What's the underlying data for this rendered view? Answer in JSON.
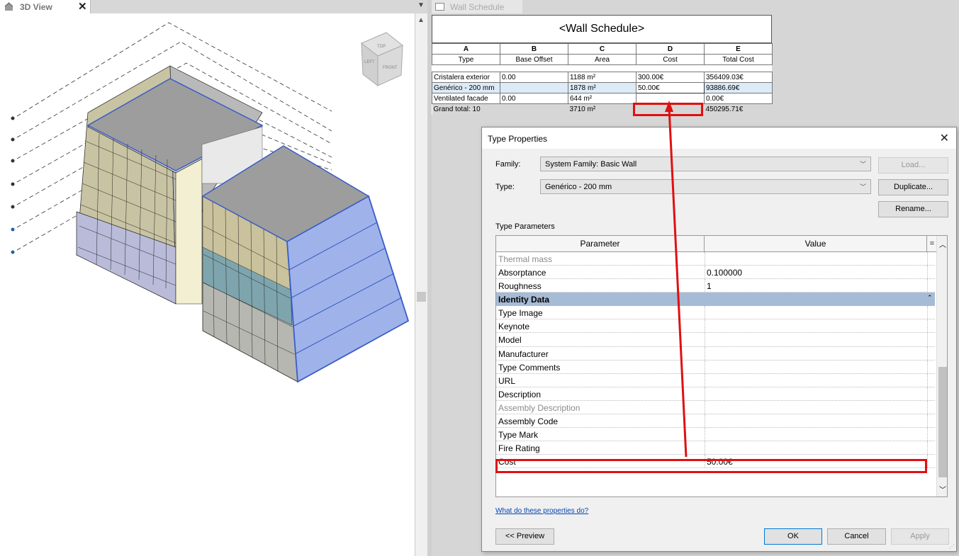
{
  "left_view": {
    "tab_label": "3D View",
    "close_glyph": "✕",
    "viewcube": {
      "top": "TOP",
      "left": "LEFT",
      "front": "FRONT"
    }
  },
  "right_view": {
    "tab_label": "Wall Schedule"
  },
  "schedule": {
    "title": "<Wall Schedule>",
    "column_letters": [
      "A",
      "B",
      "C",
      "D",
      "E"
    ],
    "column_headers": [
      "Type",
      "Base Offset",
      "Area",
      "Cost",
      "Total Cost"
    ],
    "rows": [
      [
        "Cristalera exterior",
        "0.00",
        "1188 m²",
        "300.00€",
        "356409.03€"
      ],
      [
        "Genérico - 200 mm",
        "",
        "1878 m²",
        "50.00€",
        "93886.69€"
      ],
      [
        "Ventilated facade",
        "0.00",
        "644 m²",
        "",
        "0.00€"
      ]
    ],
    "grand_total": [
      "Grand total: 10",
      "",
      "3710 m²",
      "",
      "450295.71€"
    ]
  },
  "dialog": {
    "title": "Type Properties",
    "family_label": "Family:",
    "family_value": "System Family: Basic Wall",
    "type_label": "Type:",
    "type_value": "Genérico - 200 mm",
    "load_button": "Load...",
    "duplicate_button": "Duplicate...",
    "rename_button": "Rename...",
    "type_parameters_label": "Type Parameters",
    "param_header": "Parameter",
    "value_header": "Value",
    "eq_header": "=",
    "params": [
      {
        "name": "Thermal mass",
        "value": "",
        "style": "grey"
      },
      {
        "name": "Absorptance",
        "value": "0.100000",
        "style": ""
      },
      {
        "name": "Roughness",
        "value": "1",
        "style": ""
      },
      {
        "name": "Identity Data",
        "value": "",
        "style": "group"
      },
      {
        "name": "Type Image",
        "value": "",
        "style": ""
      },
      {
        "name": "Keynote",
        "value": "",
        "style": ""
      },
      {
        "name": "Model",
        "value": "",
        "style": ""
      },
      {
        "name": "Manufacturer",
        "value": "",
        "style": ""
      },
      {
        "name": "Type Comments",
        "value": "",
        "style": ""
      },
      {
        "name": "URL",
        "value": "",
        "style": ""
      },
      {
        "name": "Description",
        "value": "",
        "style": ""
      },
      {
        "name": "Assembly Description",
        "value": "",
        "style": "grey"
      },
      {
        "name": "Assembly Code",
        "value": "",
        "style": ""
      },
      {
        "name": "Type Mark",
        "value": "",
        "style": ""
      },
      {
        "name": "Fire Rating",
        "value": "",
        "style": ""
      },
      {
        "name": "Cost",
        "value": "50.00€",
        "style": ""
      }
    ],
    "help_link": "What do these properties do?",
    "preview_button": "<< Preview",
    "ok_button": "OK",
    "cancel_button": "Cancel",
    "apply_button": "Apply"
  },
  "colors": {
    "highlight_red": "#e01010",
    "selection_blue": "#dcebf7",
    "group_header": "#a6bbd6",
    "link_blue": "#0645ad"
  }
}
